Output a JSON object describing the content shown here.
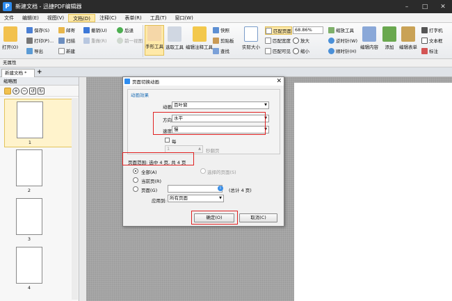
{
  "app": {
    "title": "新建文档 - 迅捷PDF编辑器",
    "logo_letter": "P"
  },
  "window_controls": {
    "minimize": "–",
    "maximize": "□",
    "close": "✕"
  },
  "menu": [
    "文件",
    "编辑(E)",
    "视图(V)",
    "文档(D)",
    "注释(C)",
    "表单(R)",
    "工具(T)",
    "窗口(W)"
  ],
  "ribbon": {
    "open": "打开(O)",
    "save": "保存(S)",
    "print": "打印(P)...",
    "export": "导出",
    "email": "邮寄",
    "scan": "扫描",
    "new": "新建",
    "undo": "撤销(U)",
    "redo": "重做(R)",
    "back": "后退",
    "forward": "前一视图",
    "hand_tool": "手形工具",
    "select_tool": "选取工具",
    "edit_annot_tool": "编辑注释工具",
    "snapshot": "快照",
    "clipboard": "剪贴板",
    "find": "查找",
    "actual_size": "实际大小",
    "fit_page": "匹配页面",
    "fit_width": "匹配宽度",
    "fit_visible": "匹配可见",
    "zoom_value": "68.86%",
    "zoom_in": "放大",
    "zoom_out": "缩小",
    "zoom_tool": "缩放工具",
    "rotate_ccw": "逆时针(W)",
    "rotate_cw": "顺时针(H)",
    "edit_content": "编辑内容",
    "add": "添加",
    "edit_form": "编辑表单",
    "typewriter": "打字机",
    "textbox": "文本框",
    "label": "标注"
  },
  "propbar": {
    "label": "无属性"
  },
  "doc_tab": {
    "label": "新建文档 *",
    "add": "+"
  },
  "thumb_panel": {
    "title": "缩略图",
    "pages": [
      {
        "num": "1",
        "selected": true
      },
      {
        "num": "2",
        "selected": false
      },
      {
        "num": "3",
        "selected": false
      },
      {
        "num": "4",
        "selected": false
      }
    ]
  },
  "dialog": {
    "title": "页面切换动画",
    "close": "✕",
    "group_label": "动画效果",
    "animation_label": "动画",
    "animation_value": "百叶窗",
    "direction_label": "方向",
    "direction_value": "水平",
    "speed_label": "速度",
    "speed_value": "慢",
    "every_label": "每",
    "every_value": "1",
    "seconds_label": "秒翻页",
    "page_range_text": "页面范围: 选中 4 页, 共 4 页",
    "all_label": "全部(A)",
    "selected_pages_label": "选择的页面(S)",
    "current_page_label": "当前页(R)",
    "pages_label": "页面(G)",
    "pages_total": "(总计 4 页)",
    "apply_to_label": "应用到:",
    "apply_to_value": "所有页面",
    "ok": "确定(O)",
    "cancel": "取消(C)"
  },
  "highlight_color": "#e02020",
  "accent_color": "#2d8cf0"
}
